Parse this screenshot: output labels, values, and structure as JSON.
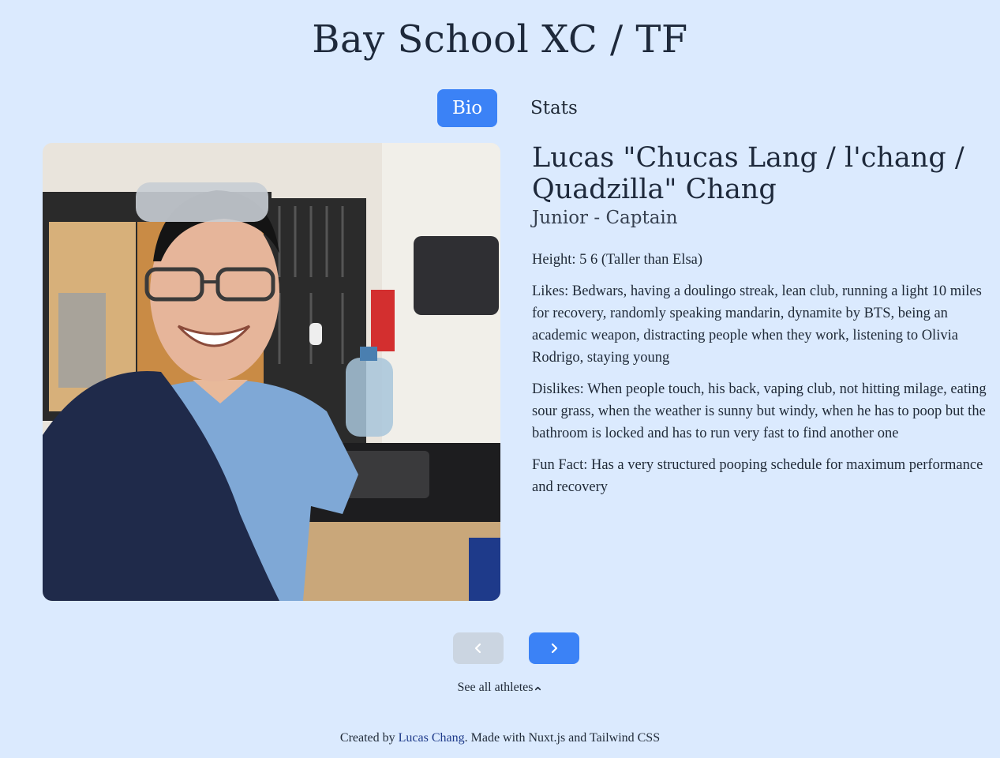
{
  "header": {
    "title": "Bay School XC / TF"
  },
  "tabs": [
    {
      "label": "Bio",
      "active": true
    },
    {
      "label": "Stats",
      "active": false
    }
  ],
  "athlete": {
    "name": "Lucas \"Chucas Lang / l'chang / Quadzilla\" Chang",
    "role": "Junior - Captain",
    "height": "Height: 5 6 (Taller than Elsa)",
    "likes": "Likes: Bedwars, having a doulingo streak, lean club, running a light 10 miles for recovery, randomly speaking mandarin, dynamite by BTS, being an academic weapon, distracting people when they work, listening to Olivia Rodrigo, staying young",
    "dislikes": "Dislikes: When people touch, his back, vaping club, not hitting milage, eating sour grass, when the weather is sunny but windy, when he has to poop but the bathroom is locked and has to run very fast to find another one",
    "fun_fact": "Fun Fact: Has a very structured pooping schedule for maximum performance and recovery"
  },
  "navigation": {
    "prev_icon": "chevron-left-icon",
    "next_icon": "chevron-right-icon",
    "prev_disabled": true,
    "see_all_label": "See all athletes"
  },
  "footer": {
    "prefix": "Created by ",
    "author": "Lucas Chang",
    "suffix": ". Made with Nuxt.js and Tailwind CSS"
  },
  "colors": {
    "background": "#dbeafe",
    "accent": "#3b82f6",
    "disabled": "#cbd5e1",
    "link": "#1e3a8a"
  }
}
